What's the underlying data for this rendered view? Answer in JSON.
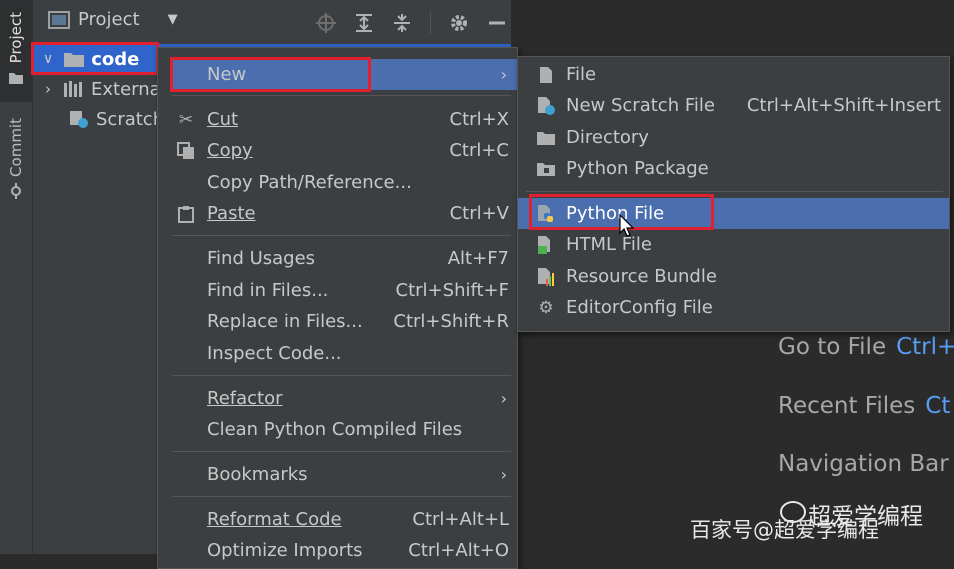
{
  "sidebar": {
    "project_tab": "Project",
    "commit_tab": "Commit"
  },
  "project_panel": {
    "title": "Project",
    "tree": {
      "code": "code",
      "external": "Externa",
      "scratch": "Scratch"
    }
  },
  "context_menu": {
    "new": "New",
    "cut": "Cut",
    "cut_sc": "Ctrl+X",
    "copy": "Copy",
    "copy_sc": "Ctrl+C",
    "copy_path": "Copy Path/Reference...",
    "paste": "Paste",
    "paste_sc": "Ctrl+V",
    "find_usages": "Find Usages",
    "find_usages_sc": "Alt+F7",
    "find_in_files": "Find in Files...",
    "find_in_files_sc": "Ctrl+Shift+F",
    "replace_in_files": "Replace in Files...",
    "replace_in_files_sc": "Ctrl+Shift+R",
    "inspect_code": "Inspect Code...",
    "refactor": "Refactor",
    "clean_python": "Clean Python Compiled Files",
    "bookmarks": "Bookmarks",
    "reformat_code": "Reformat Code",
    "reformat_code_sc": "Ctrl+Alt+L",
    "optimize_imports": "Optimize Imports",
    "optimize_imports_sc": "Ctrl+Alt+O"
  },
  "new_submenu": {
    "file": "File",
    "scratch_file": "New Scratch File",
    "scratch_file_sc": "Ctrl+Alt+Shift+Insert",
    "directory": "Directory",
    "python_package": "Python Package",
    "python_file": "Python File",
    "html_file": "HTML File",
    "resource_bundle": "Resource Bundle",
    "editorconfig": "EditorConfig File"
  },
  "editor_hints": {
    "go_to_file": "Go to File",
    "go_to_file_key": "Ctrl+",
    "recent_files": "Recent Files",
    "recent_files_key": "Ct",
    "navigation_bar": "Navigation Bar"
  },
  "watermark": {
    "line1": "超爱学编程",
    "line2": "百家号@超爱学编程"
  },
  "colors": {
    "selection": "#4b6eaf",
    "highlight_box": "#e0202f",
    "panel_bg": "#3c3f41",
    "editor_bg": "#2b2b2b"
  }
}
